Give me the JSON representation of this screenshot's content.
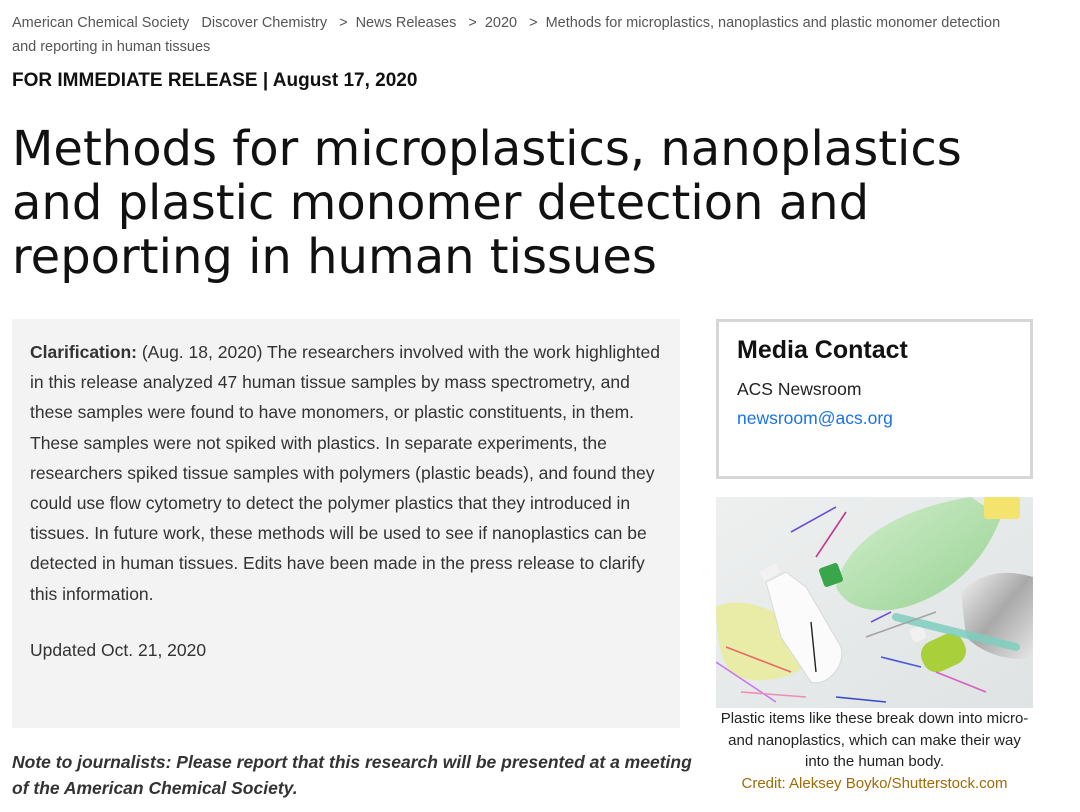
{
  "breadcrumb": {
    "items": [
      "American Chemical Society",
      "Discover Chemistry",
      "News Releases",
      "2020",
      "Methods for microplastics, nanoplastics and plastic monomer detection and reporting in human tissues"
    ],
    "separator": ">"
  },
  "release": {
    "line": "FOR IMMEDIATE RELEASE | August 17, 2020"
  },
  "page": {
    "title": "Methods for microplastics, nanoplastics and plastic monomer detection and reporting in human tissues"
  },
  "clarification": {
    "lead": "Clarification:",
    "body": "(Aug. 18, 2020) The researchers involved with the work highlighted in this release analyzed 47 human tissue samples by mass spectrometry, and these samples were found to have monomers, or plastic constituents, in them. These samples were not spiked with plastics. In separate experiments, the researchers spiked tissue samples with polymers (plastic beads), and found they could use flow cytometry to detect the polymer plastics that they introduced in tissues. In future work, these methods will be used to see if nanoplastics can be detected in human tissues. Edits have been made in the press release to clarify this information.",
    "updated": "Updated Oct. 21, 2020"
  },
  "media_contact": {
    "heading": "Media Contact",
    "name": "ACS Newsroom",
    "email": "newsroom@acs.org"
  },
  "photo": {
    "caption": "Plastic items like these break down into micro- and nanoplastics, which can make their way into the human body.",
    "credit": "Credit: Aleksey Boyko/Shutterstock.com"
  },
  "note": {
    "text": "Note to journalists: Please report that this research will be presented at a meeting of the American Chemical Society."
  },
  "colors": {
    "link_blue": "#1a73e8",
    "credit_gold": "#a06a06",
    "panel_gray": "#f3f3f3"
  }
}
